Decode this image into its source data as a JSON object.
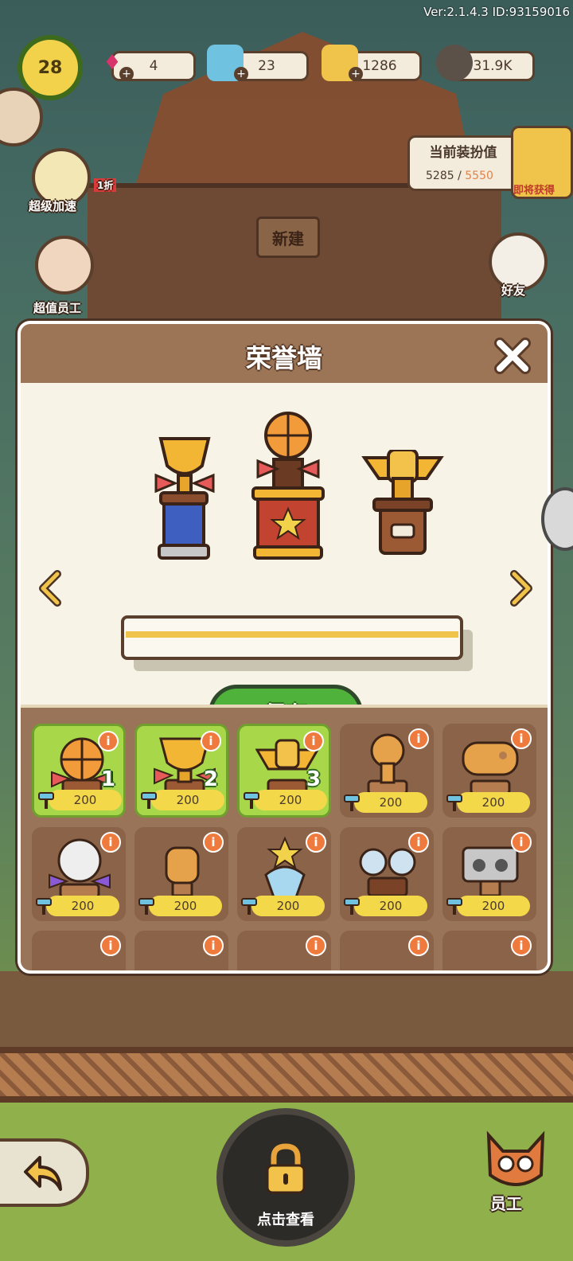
{
  "hud": {
    "version": "Ver:2.1.4.3 ID:93159016",
    "level": "28",
    "gems": "4",
    "tickets": "23",
    "cards": "1286",
    "seeds": "31.9K",
    "decor_title": "当前装扮值",
    "decor_current": "5285",
    "decor_max": "5550",
    "reward_label": "即将获得"
  },
  "side": {
    "speed_label": "超级加速",
    "speed_badge": "1折",
    "staff_offer_label": "超值员工",
    "friends_label": "好友",
    "new_build": "新建"
  },
  "dialog": {
    "title": "荣誉墙",
    "save_label": "保存",
    "slots": [
      {
        "price": "200",
        "rank": "1",
        "selected": true
      },
      {
        "price": "200",
        "rank": "2",
        "selected": true
      },
      {
        "price": "200",
        "rank": "3",
        "selected": true
      },
      {
        "price": "200",
        "rank": "",
        "selected": false
      },
      {
        "price": "200",
        "rank": "",
        "selected": false
      },
      {
        "price": "200",
        "rank": "",
        "selected": false
      },
      {
        "price": "200",
        "rank": "",
        "selected": false
      },
      {
        "price": "200",
        "rank": "",
        "selected": false
      },
      {
        "price": "200",
        "rank": "",
        "selected": false
      },
      {
        "price": "200",
        "rank": "",
        "selected": false
      }
    ]
  },
  "bottom": {
    "view_label": "点击查看",
    "staff_label": "员工"
  }
}
